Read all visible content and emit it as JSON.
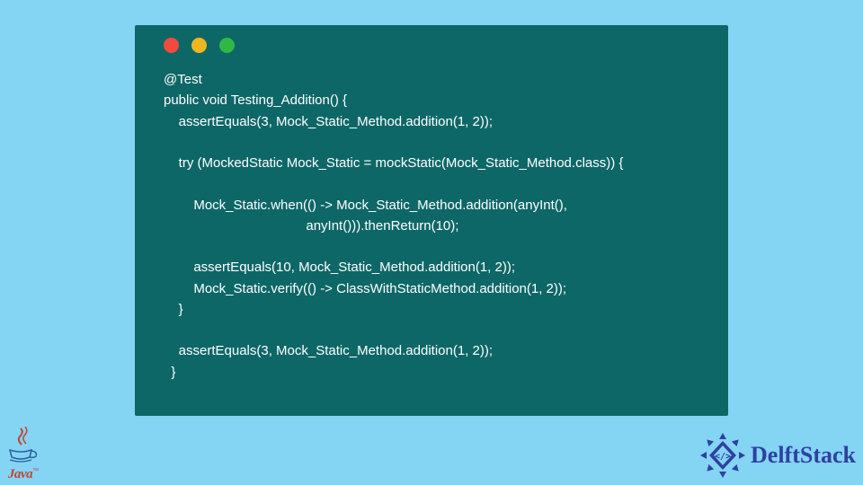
{
  "code": {
    "line1": "@Test",
    "line2": "public void Testing_Addition() {",
    "line3": "    assertEquals(3, Mock_Static_Method.addition(1, 2));",
    "line4": "",
    "line5": "    try (MockedStatic Mock_Static = mockStatic(Mock_Static_Method.class)) {",
    "line6": "",
    "line7": "        Mock_Static.when(() -> Mock_Static_Method.addition(anyInt(),",
    "line8": "                                      anyInt())).thenReturn(10);",
    "line9": "",
    "line10": "        assertEquals(10, Mock_Static_Method.addition(1, 2));",
    "line11": "        Mock_Static.verify(() -> ClassWithStaticMethod.addition(1, 2));",
    "line12": "    }",
    "line13": "",
    "line14": "    assertEquals(3, Mock_Static_Method.addition(1, 2));",
    "line15": "  }"
  },
  "logos": {
    "java_label": "Java",
    "delftstack_label": "DelftStack"
  }
}
